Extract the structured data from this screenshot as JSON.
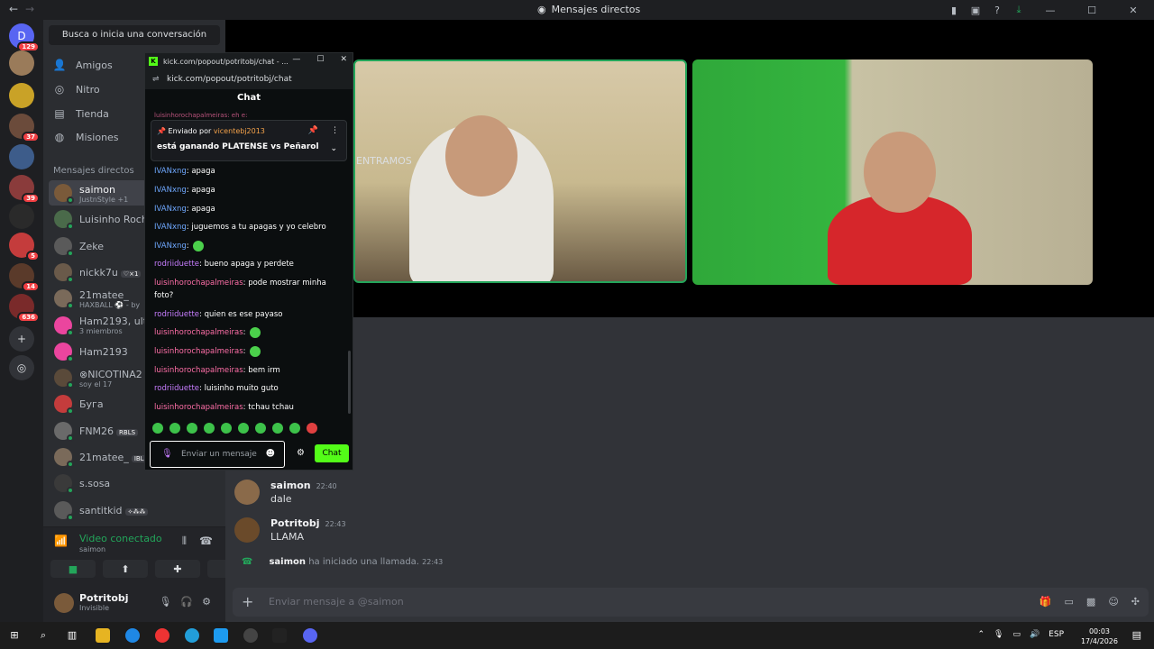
{
  "window": {
    "title": "Mensajes directos",
    "back": "←",
    "forward": "→"
  },
  "titlebar_icons": [
    "bookmark-icon",
    "screen-icon",
    "help-icon",
    "download-icon",
    "minimize-icon",
    "maximize-icon",
    "close-icon"
  ],
  "servers": [
    {
      "label": "D",
      "badge": "129",
      "color": "#5865f2"
    },
    {
      "label": "",
      "badge": "",
      "color": "#9a7b5a"
    },
    {
      "label": "",
      "badge": "",
      "color": "#c9a227"
    },
    {
      "label": "",
      "badge": "37",
      "color": "#6b4b3b"
    },
    {
      "label": "",
      "badge": "",
      "color": "#3d5c8a"
    },
    {
      "label": "",
      "badge": "39",
      "color": "#8a3b3b"
    },
    {
      "label": "",
      "badge": "",
      "color": "#2a2a2a"
    },
    {
      "label": "",
      "badge": "5",
      "color": "#c43c3c"
    },
    {
      "label": "",
      "badge": "14",
      "color": "#5a3a2a"
    },
    {
      "label": "",
      "badge": "636",
      "color": "#7a2a2a"
    }
  ],
  "search": {
    "placeholder": "Busca o inicia una conversación"
  },
  "nav": [
    {
      "label": "Amigos",
      "icon": "👤"
    },
    {
      "label": "Nitro",
      "icon": "◎"
    },
    {
      "label": "Tienda",
      "icon": "▤"
    },
    {
      "label": "Misiones",
      "icon": "◍"
    }
  ],
  "dm_header": "Mensajes directos",
  "dms": [
    {
      "name": "saimon",
      "sub": "JustnStyle +1",
      "tag": "",
      "active": true,
      "color": "#7a5a3a"
    },
    {
      "name": "Luisinho Rocha",
      "sub": "",
      "tag": "",
      "active": false,
      "color": "#4a6a4a"
    },
    {
      "name": "Zeke",
      "sub": "",
      "tag": "",
      "active": false,
      "color": "#5a5a5a"
    },
    {
      "name": "nickk7u",
      "sub": "",
      "tag": "♡×1",
      "active": false,
      "color": "#6a5a4a"
    },
    {
      "name": "21mateе_",
      "sub": "HAXBALL ⚽ - by",
      "tag": "",
      "active": false,
      "color": "#7a6a5a"
    },
    {
      "name": "Ham2193, ultron",
      "sub": "3 miembros",
      "tag": "",
      "active": false,
      "color": "#eb459e"
    },
    {
      "name": "Ham2193",
      "sub": "",
      "tag": "",
      "active": false,
      "color": "#eb459e"
    },
    {
      "name": "⊗NICOTINA2",
      "sub": "soy el 17",
      "tag": "",
      "active": false,
      "color": "#5a4a3a"
    },
    {
      "name": "Буга",
      "sub": "",
      "tag": "",
      "active": false,
      "color": "#c43c3c"
    },
    {
      "name": "FNM26",
      "sub": "",
      "tag": "RBLS",
      "active": false,
      "color": "#6a6a6a"
    },
    {
      "name": "21matee_",
      "sub": "",
      "tag": "IBL",
      "active": false,
      "color": "#7a6a5a"
    },
    {
      "name": "s.sosa",
      "sub": "",
      "tag": "",
      "active": false,
      "color": "#3a3a3a"
    },
    {
      "name": "santitkid",
      "sub": "",
      "tag": "✧⁂⁂",
      "active": false,
      "color": "#5a5a5a"
    }
  ],
  "voice": {
    "title": "Video conectado",
    "sub": "saimon"
  },
  "user": {
    "name": "Potritobj",
    "status": "Invisible"
  },
  "messages": [
    {
      "author": "saimon",
      "time": "22:40",
      "text": "dale"
    },
    {
      "author": "Potritobj",
      "time": "22:43",
      "text": "LLAMA"
    }
  ],
  "entramos": "ENTRAMOS",
  "system_msg": {
    "author": "saimon",
    "text": "ha iniciado una llamada.",
    "time": "22:43"
  },
  "composer": {
    "placeholder": "Enviar mensaje a @saimon"
  },
  "popout": {
    "tab_title": "kick.com/popout/potritobj/chat - ...",
    "url": "kick.com/popout/potritobj/chat",
    "header": "Chat",
    "cut_line": "luisinhorochapalmeiras: eh e:",
    "pinned_by_label": "Enviado por",
    "pinned_by_user": "vicentebj2013",
    "pinned_text": "está ganando PLATENSE vs Peñarol",
    "lines": [
      {
        "user": "IVANxng",
        "cls": "u1",
        "text": ": apaga"
      },
      {
        "user": "IVANxng",
        "cls": "u1",
        "text": ": apaga"
      },
      {
        "user": "IVANxng",
        "cls": "u1",
        "text": ": apaga"
      },
      {
        "user": "IVANxng",
        "cls": "u1",
        "text": ": juguemos a tu apagas y yo celebro"
      },
      {
        "user": "IVANxng",
        "cls": "u1",
        "text": ":"
      },
      {
        "user": "rodriiduette",
        "cls": "u2",
        "text": ": bueno apaga y perdete"
      },
      {
        "user": "luisinhorochapalmeiras",
        "cls": "u3",
        "text": ": pode mostrar minha foto?"
      },
      {
        "user": "rodriiduette",
        "cls": "u2",
        "text": ": quien es ese payaso"
      },
      {
        "user": "luisinhorochapalmeiras",
        "cls": "u3",
        "text": ":"
      },
      {
        "user": "luisinhorochapalmeiras",
        "cls": "u3",
        "text": ":"
      },
      {
        "user": "luisinhorochapalmeiras",
        "cls": "u3",
        "text": ": bem irm"
      },
      {
        "user": "rodriiduette",
        "cls": "u2",
        "text": ": luisinho muito guto"
      },
      {
        "user": "luisinhorochapalmeiras",
        "cls": "u3",
        "text": ": tchau tchau"
      }
    ],
    "input_placeholder": "Enviar un mensaje",
    "send_label": "Chat"
  },
  "taskbar": {
    "lang": "ESP",
    "time": "00:03",
    "date": "17/4/2026"
  }
}
